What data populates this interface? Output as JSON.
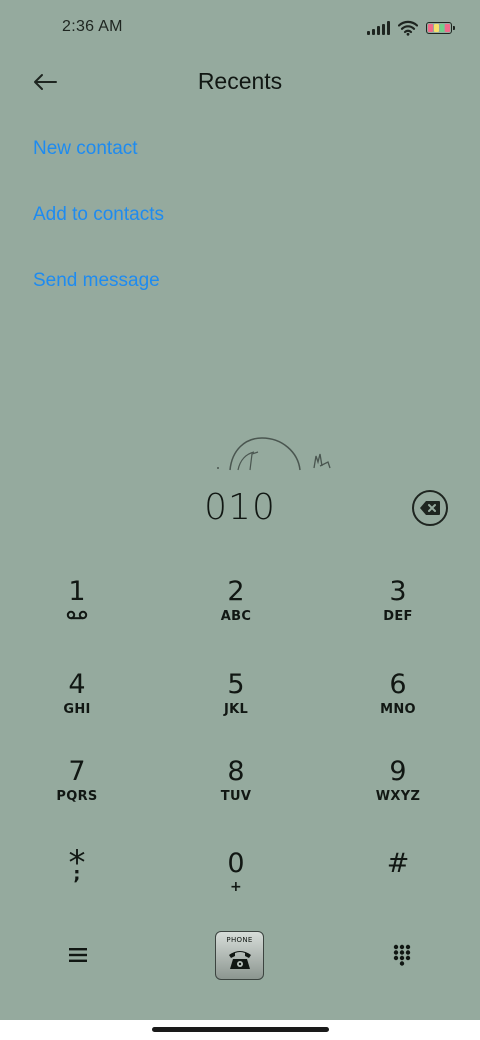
{
  "status_bar": {
    "time": "2:36 AM",
    "icons": [
      "signal-icon",
      "wifi-icon",
      "battery-icon"
    ]
  },
  "header": {
    "title": "Recents",
    "back_icon": "arrow-left-icon"
  },
  "actions": {
    "new_contact": "New contact",
    "add_to_contacts": "Add to contacts",
    "send_message": "Send message"
  },
  "dialer": {
    "number": "010",
    "backspace_icon": "backspace-icon"
  },
  "keypad": [
    {
      "digit": "1",
      "letters": "",
      "sub_icon": "voicemail-icon"
    },
    {
      "digit": "2",
      "letters": "ABC"
    },
    {
      "digit": "3",
      "letters": "DEF"
    },
    {
      "digit": "4",
      "letters": "GHI"
    },
    {
      "digit": "5",
      "letters": "JKL"
    },
    {
      "digit": "6",
      "letters": "MNO"
    },
    {
      "digit": "7",
      "letters": "PQRS"
    },
    {
      "digit": "8",
      "letters": "TUV"
    },
    {
      "digit": "9",
      "letters": "WXYZ"
    },
    {
      "digit": "*",
      "letters": ";"
    },
    {
      "digit": "0",
      "letters": "+"
    },
    {
      "digit": "#",
      "letters": ""
    }
  ],
  "bottom_bar": {
    "menu_icon": "menu-icon",
    "call_button_label": "PHONE",
    "call_icon": "telephone-icon",
    "dialpad_icon": "dialpad-grid-icon"
  },
  "colors": {
    "background": "#95aa9e",
    "link": "#1e8bf0",
    "text": "#111713"
  }
}
